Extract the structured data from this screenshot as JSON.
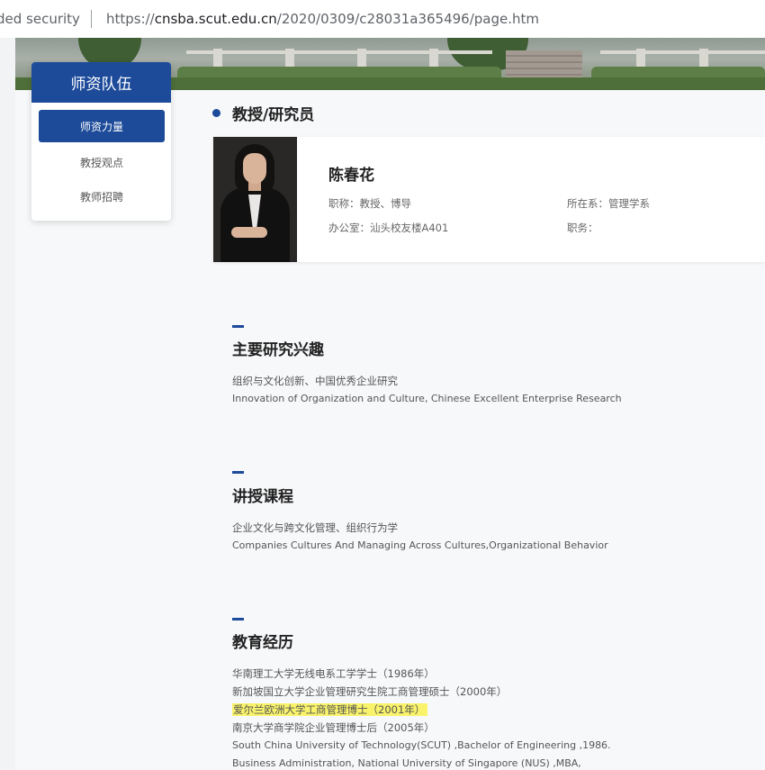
{
  "address_bar": {
    "security_text": "ded security",
    "url_prefix": "https://",
    "url_host": "cnsba.scut.edu.cn",
    "url_path": "/2020/0309/c28031a365496/page.htm"
  },
  "side_nav": {
    "title": "师资队伍",
    "items": [
      {
        "label": "师资力量",
        "active": true
      },
      {
        "label": "教授观点",
        "active": false
      },
      {
        "label": "教师招聘",
        "active": false
      }
    ]
  },
  "section": {
    "title": "教授/研究员"
  },
  "profile": {
    "name": "陈春花",
    "title_field": "职称：教授、博导",
    "department_field": "所在系：管理学系",
    "office_field": "办公室：汕头校友楼A401",
    "position_field": "职务："
  },
  "research": {
    "heading": "主要研究兴趣",
    "cn": "组织与文化创新、中国优秀企业研究",
    "en": "Innovation of Organization and Culture, Chinese Excellent Enterprise  Research"
  },
  "courses": {
    "heading": "讲授课程",
    "cn": "企业文化与跨文化管理、组织行为学",
    "en": "Companies Cultures And Managing Across Cultures,Organizational Behavior"
  },
  "education": {
    "heading": "教育经历",
    "items": [
      "华南理工大学无线电系工学学士（1986年）",
      "新加坡国立大学企业管理研究生院工商管理硕士（2000年）",
      "爱尔兰欧洲大学工商管理博士（2001年）",
      "南京大学商学院企业管理博士后（2005年）",
      "South China University of Technology(SCUT) ,Bachelor of Engineering ,1986.",
      "Business Administration, National University of Singapore (NUS) ,MBA,"
    ],
    "highlight_color": "#f9f36c"
  },
  "colors": {
    "accent": "#1d4b9a"
  }
}
